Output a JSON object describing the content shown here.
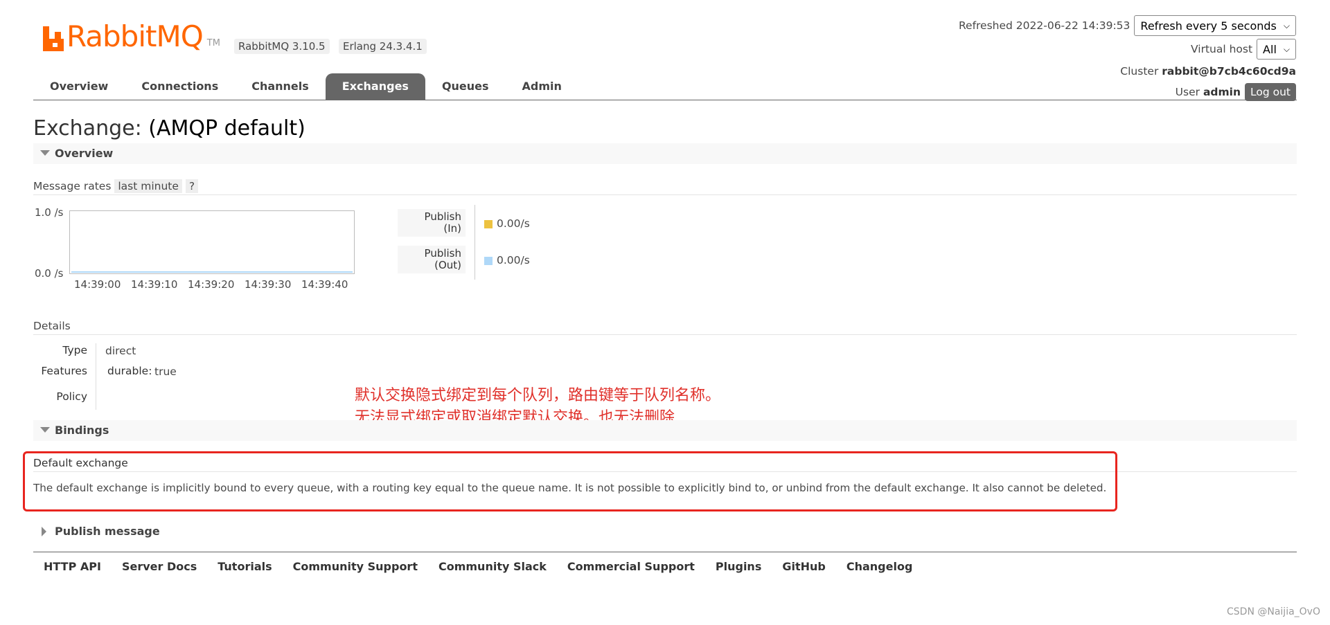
{
  "brand": {
    "logo_text": "RabbitMQ",
    "logo_tm": "TM",
    "accent": "#ff6600"
  },
  "versions": {
    "rabbitmq": "RabbitMQ 3.10.5",
    "erlang": "Erlang 24.3.4.1"
  },
  "header": {
    "refreshed_label": "Refreshed 2022-06-22 14:39:53",
    "refresh_select": "Refresh every 5 seconds",
    "vhost_label": "Virtual host",
    "vhost_select": "All",
    "cluster_label": "Cluster",
    "cluster_value": "rabbit@b7cb4c60cd9a",
    "user_label": "User",
    "user_value": "admin",
    "logout": "Log out"
  },
  "nav": {
    "tabs": [
      "Overview",
      "Connections",
      "Channels",
      "Exchanges",
      "Queues",
      "Admin"
    ],
    "active": "Exchanges"
  },
  "page": {
    "title_prefix": "Exchange:",
    "title_name": "(AMQP default)"
  },
  "overview": {
    "section_label": "Overview",
    "rates_label": "Message rates",
    "rates_range": "last minute",
    "help": "?",
    "chart_data": {
      "type": "line",
      "y_ticks": [
        "1.0 /s",
        "0.0 /s"
      ],
      "x_ticks": [
        "14:39:00",
        "14:39:10",
        "14:39:20",
        "14:39:30",
        "14:39:40"
      ],
      "ylim": [
        0,
        1
      ],
      "series": [
        {
          "name": "Publish (In)",
          "values": [
            0,
            0,
            0,
            0,
            0
          ],
          "color": "#edc240"
        },
        {
          "name": "Publish (Out)",
          "values": [
            0,
            0,
            0,
            0,
            0
          ],
          "color": "#afd8f8"
        }
      ]
    },
    "legend": [
      {
        "line1": "Publish",
        "line2": "(In)",
        "value": "0.00/s",
        "color": "#edc240"
      },
      {
        "line1": "Publish",
        "line2": "(Out)",
        "value": "0.00/s",
        "color": "#afd8f8"
      }
    ]
  },
  "details": {
    "label": "Details",
    "type_key": "Type",
    "type_val": "direct",
    "features_key": "Features",
    "durable_key": "durable:",
    "durable_val": "true",
    "policy_key": "Policy"
  },
  "annotation": {
    "line1": "默认交换隐式绑定到每个队列，路由键等于队列名称。",
    "line2": "无法显式绑定或取消绑定默认交换。也无法删除",
    "color": "#e0302a"
  },
  "bindings": {
    "section_label": "Bindings",
    "title": "Default exchange",
    "text": "The default exchange is implicitly bound to every queue, with a routing key equal to the queue name. It is not possible to explicitly bind to, or unbind from the default exchange. It also cannot be deleted."
  },
  "publish": {
    "section_label": "Publish message"
  },
  "footer": {
    "links": [
      "HTTP API",
      "Server Docs",
      "Tutorials",
      "Community Support",
      "Community Slack",
      "Commercial Support",
      "Plugins",
      "GitHub",
      "Changelog"
    ]
  },
  "watermark": "CSDN @Naijia_OvO"
}
